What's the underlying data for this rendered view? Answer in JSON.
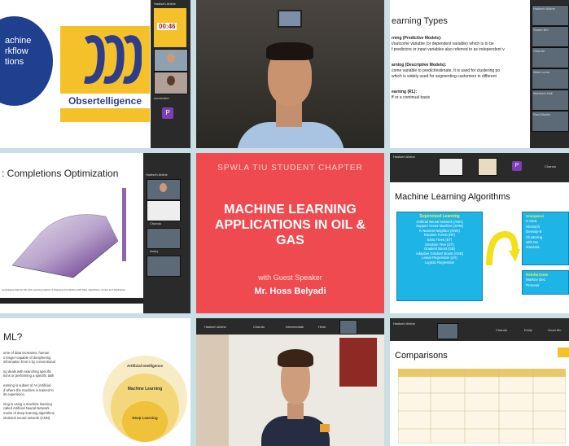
{
  "tile1": {
    "workflow_text": [
      "achine",
      "rkflow",
      "tions"
    ],
    "company_name": "Obsertelligence",
    "timer": "00:46",
    "participants": [
      "Hadiseh Ahkhe",
      "connected"
    ],
    "p_label": "P"
  },
  "tile3": {
    "heading": "earning Types",
    "lines": [
      "rning (Predictive Models):",
      "t/outcome variable (or dependent variable) which is to be",
      "f predictors or input variables also referred to as independent v",
      "arning (Descriptive Models):",
      "come variable to predict/estimate. It is used for clustering po",
      "which is widely used for segmenting customers in different",
      "earning (RL):",
      "ff or a continual basis"
    ],
    "participants": [
      "Hadiseh Ahkhe",
      "Shohe Bel",
      "Chandu",
      "Allan Luma",
      "Manhout Hali",
      "Ravi Bhutta"
    ]
  },
  "tile4": {
    "title": ": Completions Optimization",
    "caption": "Leveraging Data for ML and Learning Optical: A Stepping Foundation with Data, Algorithms, Codes and Application",
    "participants": [
      "Hadiseh Ahkhe",
      "Chandu",
      "Amey"
    ]
  },
  "tile5": {
    "event": "SPWLA TIU STUDENT CHAPTER",
    "title": "MACHINE LEARNING APPLICATIONS IN OIL & GAS",
    "guest_label": "with Guest Speaker",
    "speaker": "Mr. Hoss Belyadi"
  },
  "tile6": {
    "header_name": "Hadiseh Ahkhe",
    "header_right": "Chandu",
    "p_label": "P",
    "title": "Machine Learning Algorithms",
    "supervised_heading": "Supervised Learning",
    "supervised_items": [
      "Artificial Neural Network (ANN)",
      "Support Vector Machine (SVM)",
      "K Nearest Neighbor (KNN)",
      "Random Forest (RF)",
      "Extra Trees (ET)",
      "Decision Tree (DT)",
      "Gradient Boost (GB)",
      "Adaptive Gradient Boost (AGB)",
      "Linear Regression (LR)",
      "Logistic Regression"
    ],
    "unsupervised_heading": "Unsupervi",
    "unsupervised_items": [
      "K-mea",
      "Hierarch",
      "Density-B",
      "Clustering",
      "with No",
      "Gaussia"
    ],
    "reinforcement_heading": "Reinforceme",
    "reinforcement_items": [
      "Markov Dec",
      "Process"
    ]
  },
  "tile7": {
    "heading": "ML?",
    "text_lines": [
      "ume of data increases, human",
      "o longer capable of deciphering",
      "information from it by conventional",
      "ng deals with searching specific",
      "tions or performing a specific task",
      "earning is subset of AI (Artificial",
      "d where the machine is trained to",
      "its experience.",
      "ning is using a machine learning",
      "called Artificial Neural Network",
      "mains of deep learning algorithms",
      "olutional neural network (CNN)"
    ],
    "rings": [
      "Artificial Intelligence",
      "Machine Learning",
      "Deep Learning"
    ]
  },
  "tile8": {
    "participants": [
      "Hadiseh Ahkhe",
      "Chandu",
      "Intermediate",
      "Hesh"
    ]
  },
  "tile9": {
    "participants": [
      "Hadiseh Ahkhe",
      "Chandu",
      "Emily",
      "Good Mo"
    ],
    "title": "Comparisons"
  }
}
